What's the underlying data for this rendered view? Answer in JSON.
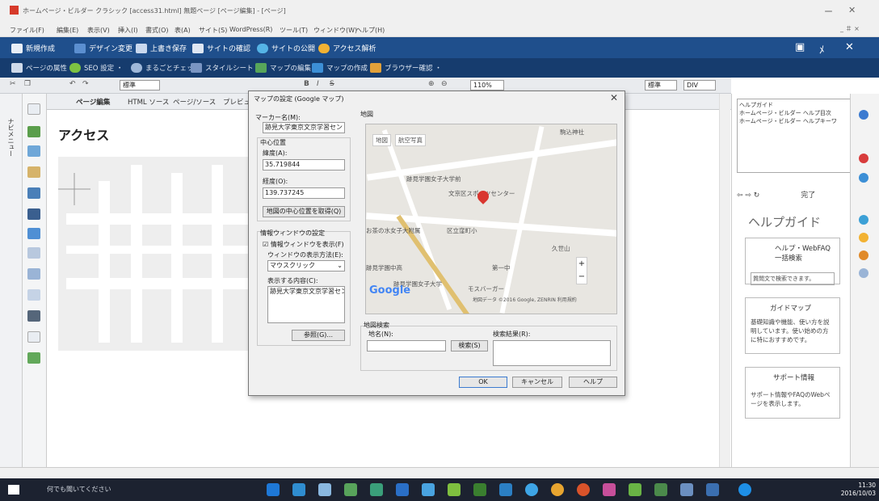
{
  "window": {
    "title": "ホームページ・ビルダー クラシック  [access31.html]  無題ページ [ページ編集]  - [ページ]",
    "controls": [
      "ー",
      "✕"
    ]
  },
  "menu": {
    "items": [
      "ファイル(F)",
      "編集(E)",
      "表示(V)",
      "挿入(I)",
      "書式(O)",
      "表(A)",
      "サイト(S)",
      "WordPress(R)",
      "ツール(T)",
      "ウィンドウ(W)",
      "ヘルプ(H)"
    ],
    "right": "_ ＃ ×"
  },
  "toolbar1": {
    "items": [
      "新規作成",
      "デザイン変更",
      "上書き保存",
      "サイトの確認",
      "サイトの公開",
      "アクセス解析"
    ],
    "right": [
      "▣",
      "ﾒ",
      "✕"
    ]
  },
  "toolbar2": {
    "items": [
      "ページの属性",
      "SEO 設定 ・",
      "まるごとチェック",
      "スタイルシート",
      "マップの編集",
      "マップの作成",
      "ブラウザー確認 ・"
    ]
  },
  "format_bar": {
    "style_select": "標準",
    "bold": "B",
    "italic": "I",
    "strike": "S",
    "zoom": "110%",
    "right_selects": [
      "標準",
      "DIV"
    ]
  },
  "side": {
    "label": "ナビメニュー"
  },
  "tabs": [
    "ページ編集",
    "HTML ソース",
    "ページ/ソース",
    "プレビュー"
  ],
  "editor": {
    "heading": "アクセス"
  },
  "dialog": {
    "title": "マップの設定 (Google マップ)",
    "close": "✕",
    "marker_label": "マーカー名(M):",
    "marker_value": "跡見大学東京文京学習セン",
    "center_group": "中心位置",
    "lat_label": "緯度(A):",
    "lat_value": "35.719844",
    "lng_label": "経度(O):",
    "lng_value": "139.737245",
    "get_center_btn": "地図の中心位置を取得(Q)",
    "info_group": "情報ウィンドウの設定",
    "show_info_label": "情報ウィンドウを表示(F)",
    "show_method_label": "ウィンドウの表示方法(E):",
    "show_method_value": "マウスクリック",
    "content_label": "表示する内容(C):",
    "content_value": "跡見大学東京文京学習セン",
    "browse_btn": "参照(G)...",
    "map_label": "地図",
    "search_group": "地図検索",
    "place_label": "地名(N):",
    "search_btn": "検索(S)",
    "result_label": "検索結果(R):",
    "ok_btn": "OK",
    "cancel_btn": "キャンセル",
    "help_btn": "ヘルプ"
  },
  "map": {
    "tab_map": "地図",
    "tab_sat": "航空写真",
    "labels": [
      "駒込神社",
      "跡見学園女子大学前",
      "文京区スポーツセンター",
      "お茶の水女子大附属",
      "区立窪町小",
      "久世山",
      "第一中",
      "跡見学園女子大学",
      "モスバーガー",
      "跡見学園中高"
    ],
    "google": "Google",
    "copyright": "地図データ ©2016 Google, ZENRIN  利用規約"
  },
  "right_panel": {
    "tree": [
      "ヘルプガイド",
      "ホームページ・ビルダー ヘルプ目次",
      "ホームページ・ビルダー ヘルプキーワ"
    ],
    "nav_done": "完了",
    "help_title": "ヘルプガイド",
    "card1_title": "ヘルプ・WebFAQ 一括検索",
    "card1_input": "質問文で検索できます。",
    "card2_title": "ガイドマップ",
    "card2_text": "基礎知識や機能、使い方を説明しています。使い始めの方に特におすすめです。",
    "card3_title": "サポート情報",
    "card3_text": "サポート情報やFAQのWebページを表示します。"
  },
  "taskbar": {
    "search_placeholder": "何でも聞いてください",
    "time": "11:30",
    "date": "2016/10/03"
  }
}
